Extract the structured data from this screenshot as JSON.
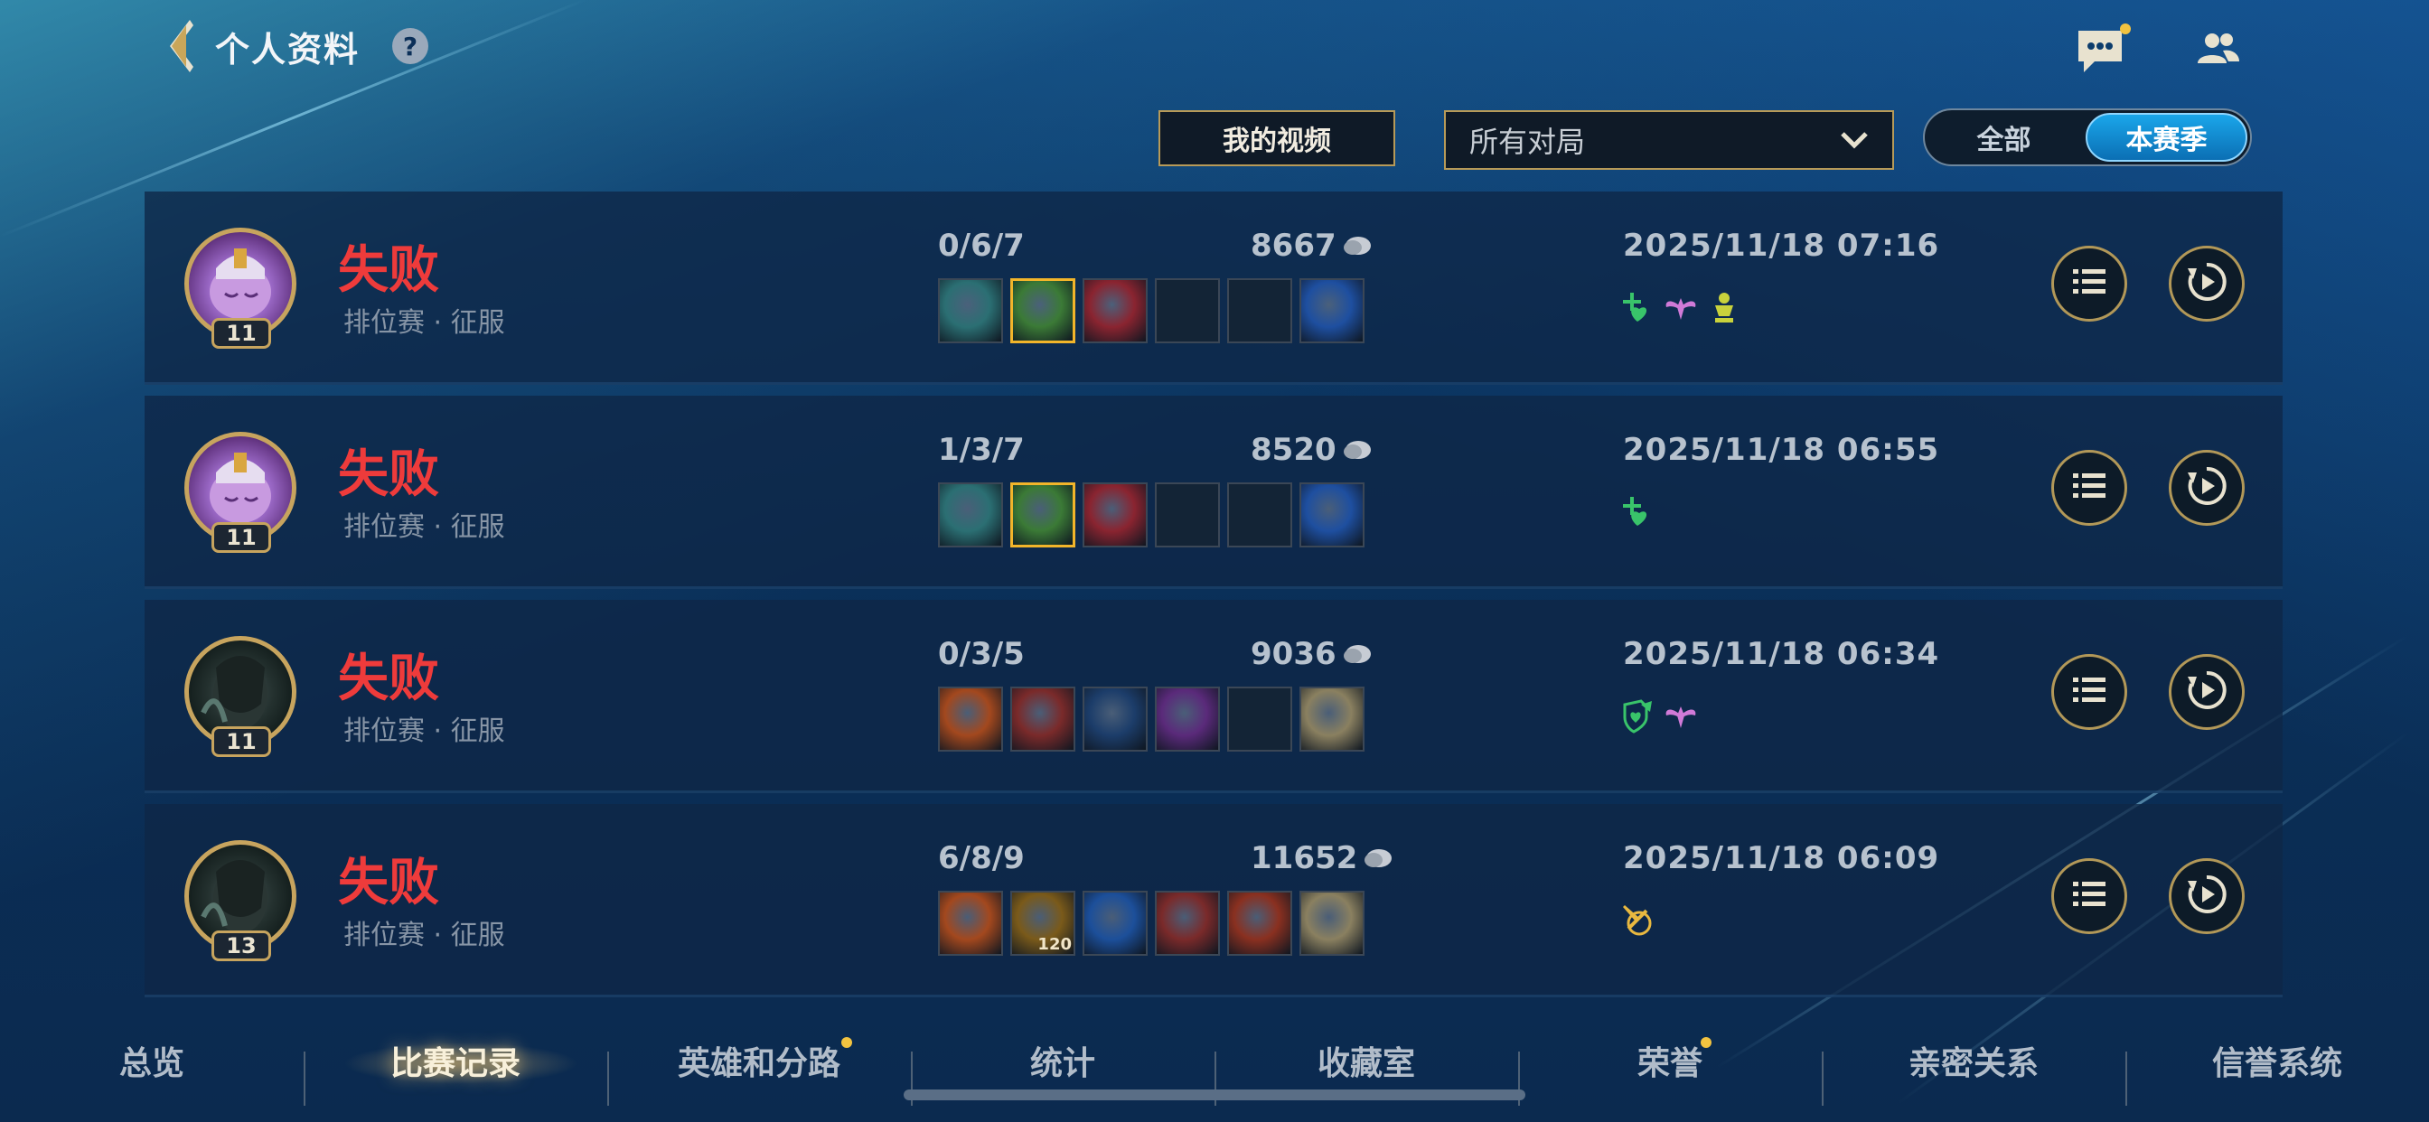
{
  "header": {
    "title": "个人资料",
    "help": "?"
  },
  "filters": {
    "my_video": "我的视频",
    "match_type": "所有对局",
    "season_toggle": [
      {
        "label": "全部",
        "active": false
      },
      {
        "label": "本赛季",
        "active": true
      }
    ]
  },
  "matches": [
    {
      "result": "失败",
      "mode": "排位赛 · 征服",
      "level": "11",
      "avatar": "purple",
      "kda": "0/6/7",
      "gold": "8667",
      "date": "2025/11/18 07:16",
      "items": [
        {
          "icon": "teal-blade-item",
          "color": "#2b6f73"
        },
        {
          "icon": "green-mask-item",
          "color": "#3b7a36",
          "highlight": true
        },
        {
          "icon": "red-claw-item",
          "color": "#8a2430"
        },
        {
          "icon": "empty-slot",
          "color": "#132436"
        },
        {
          "icon": "empty-slot",
          "color": "#132436"
        },
        {
          "icon": "golden-lantern-trinket",
          "color": "#1e4fa0"
        }
      ],
      "honors": [
        "heal-honor-icon",
        "wings-honor-icon",
        "trophy-honor-icon"
      ]
    },
    {
      "result": "失败",
      "mode": "排位赛 · 征服",
      "level": "11",
      "avatar": "purple",
      "kda": "1/3/7",
      "gold": "8520",
      "date": "2025/11/18 06:55",
      "items": [
        {
          "icon": "teal-blade-item",
          "color": "#2b6f73"
        },
        {
          "icon": "green-mask-item",
          "color": "#3b7a36",
          "highlight": true
        },
        {
          "icon": "red-claw-item",
          "color": "#8a2430"
        },
        {
          "icon": "empty-slot",
          "color": "#132436"
        },
        {
          "icon": "empty-slot",
          "color": "#132436"
        },
        {
          "icon": "golden-lantern-trinket",
          "color": "#1e4fa0"
        }
      ],
      "honors": [
        "heal-honor-icon"
      ]
    },
    {
      "result": "失败",
      "mode": "排位赛 · 征服",
      "level": "11",
      "avatar": "dark",
      "kda": "0/3/5",
      "gold": "9036",
      "date": "2025/11/18 06:34",
      "items": [
        {
          "icon": "bronze-gauntlet-item",
          "color": "#a3481e"
        },
        {
          "icon": "red-armor-item",
          "color": "#7a2a2a"
        },
        {
          "icon": "gold-boots-item",
          "color": "#1c3d6a"
        },
        {
          "icon": "purple-tome-item",
          "color": "#5a2a7a"
        },
        {
          "icon": "empty-slot",
          "color": "#132436"
        },
        {
          "icon": "silver-armor-trinket",
          "color": "#8a8060"
        }
      ],
      "honors": [
        "shield-honor-icon",
        "wings-honor-icon"
      ]
    },
    {
      "result": "失败",
      "mode": "排位赛 · 征服",
      "level": "13",
      "avatar": "dark",
      "kda": "6/8/9",
      "gold": "11652",
      "date": "2025/11/18 06:09",
      "items": [
        {
          "icon": "bronze-gauntlet-item",
          "color": "#a3481e"
        },
        {
          "icon": "gold-orb-item",
          "color": "#7a5a1a",
          "count": "120"
        },
        {
          "icon": "blue-crystal-item",
          "color": "#1c4f9a"
        },
        {
          "icon": "red-armor-item",
          "color": "#7a2a2a"
        },
        {
          "icon": "red-book-item",
          "color": "#8a3020"
        },
        {
          "icon": "silver-armor-trinket",
          "color": "#8a8060"
        }
      ],
      "honors": [
        "swords-honor-icon"
      ]
    }
  ],
  "nav": [
    {
      "label": "总览"
    },
    {
      "label": "比赛记录",
      "active": true
    },
    {
      "label": "英雄和分路",
      "dot": true
    },
    {
      "label": "统计"
    },
    {
      "label": "收藏室"
    },
    {
      "label": "荣誉",
      "dot": true
    },
    {
      "label": "亲密关系"
    },
    {
      "label": "信誉系统"
    }
  ],
  "colors": {
    "loss": "#ee3b3b",
    "gold_border": "#b79a58",
    "accent_blue": "#1aa6ea"
  }
}
